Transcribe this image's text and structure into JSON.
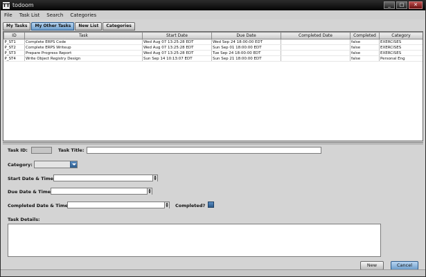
{
  "window": {
    "title": "todoom",
    "app_icon_label": "TT",
    "min_label": "_",
    "max_label": "□",
    "close_label": "✕"
  },
  "menu": [
    "File",
    "Task List",
    "Search",
    "Categories"
  ],
  "tabs": [
    "My Tasks",
    "My Other Tasks",
    "New List",
    "Categories"
  ],
  "active_tab": 1,
  "table": {
    "columns": [
      "ID",
      "Task",
      "Start Date",
      "Due Date",
      "Completed Date",
      "Completed",
      "Category"
    ],
    "rows": [
      [
        "P_ST1",
        "Complete ERPS Code",
        "Wed Aug 07 13:25:28 EDT",
        "Wed Sep 24 18:00:00 EDT",
        "",
        "false",
        "EXERCISES"
      ],
      [
        "P_ST2",
        "Complete ERPS Writeup",
        "Wed Aug 07 13:25:28 EDT",
        "Sun Sep 01 18:00:00 EDT",
        "",
        "false",
        "EXERCISES"
      ],
      [
        "P_ST3",
        "Prepare Progress Report",
        "Wed Aug 07 13:25:28 EDT",
        "Tue Sep 24 18:00:00 EDT",
        "",
        "false",
        "EXERCISES"
      ],
      [
        "P_ST4",
        "Write Object Registry Design",
        "Sun Sep 14 10:13:07 EDT",
        "Sun Sep 21 18:00:00 EDT",
        "",
        "false",
        "Personal Eng"
      ]
    ]
  },
  "form": {
    "task_id_label": "Task ID:",
    "task_title_label": "Task Title:",
    "category_label": "Category:",
    "start_label": "Start Date & Time:",
    "due_label": "Due Date & Time:",
    "completed_date_label": "Completed Date & Time:",
    "completed_label": "Completed?",
    "details_label": "Task Details:"
  },
  "buttons": {
    "new": "New",
    "cancel": "Cancel"
  },
  "colors": {
    "accent": "#6e9ecb",
    "titlebar": "#050505"
  }
}
